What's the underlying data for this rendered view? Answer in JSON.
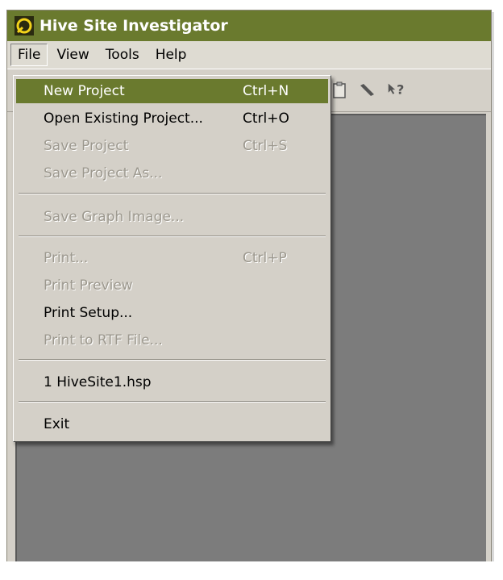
{
  "app": {
    "title": "Hive Site Investigator"
  },
  "menubar": {
    "items": [
      {
        "label": "File"
      },
      {
        "label": "View"
      },
      {
        "label": "Tools"
      },
      {
        "label": "Help"
      }
    ]
  },
  "toolbar": {
    "visible_icons": [
      "clipboard-icon",
      "pencil-icon",
      "help-pointer-icon"
    ]
  },
  "file_menu": {
    "items": [
      {
        "label": "New Project",
        "shortcut": "Ctrl+N"
      },
      {
        "label": "Open Existing Project...",
        "shortcut": "Ctrl+O"
      },
      {
        "label": "Save Project",
        "shortcut": "Ctrl+S"
      },
      {
        "label": "Save Project As..."
      },
      {
        "label": "Save Graph Image..."
      },
      {
        "label": "Print...",
        "shortcut": "Ctrl+P"
      },
      {
        "label": "Print Preview"
      },
      {
        "label": "Print Setup..."
      },
      {
        "label": "Print to RTF File..."
      },
      {
        "label": "1 HiveSite1.hsp"
      },
      {
        "label": "Exit"
      }
    ]
  },
  "colors": {
    "accent": "#6a7a2e",
    "workspace": "#7c7c7c",
    "chrome": "#d4d0c8"
  }
}
